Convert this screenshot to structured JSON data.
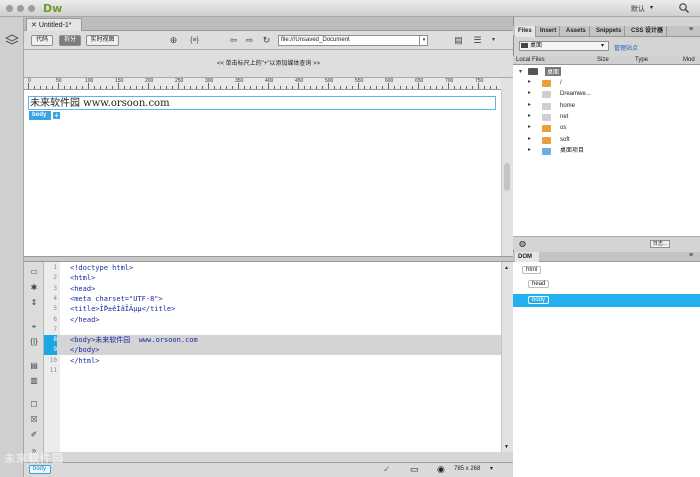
{
  "app": {
    "logo": "Dw",
    "workspace": "默认"
  },
  "document": {
    "tab_title": "Untitled-1*"
  },
  "toolbar": {
    "views": [
      "代码",
      "拆分",
      "实时视图"
    ],
    "active_view": "拆分",
    "address": "file:///Unsaved_Document"
  },
  "media_hint": "<< 单击标尺上的\"+\"以添加媒体查询 >>",
  "ruler": {
    "labels": [
      "0",
      "50",
      "100",
      "150",
      "200",
      "250",
      "300",
      "350",
      "400",
      "450",
      "500",
      "550",
      "600",
      "650",
      "700",
      "750"
    ]
  },
  "design": {
    "body_text": "未来软件园 www.orsoon.com",
    "body_tag": "body",
    "plus": "+"
  },
  "code": {
    "lines": [
      {
        "n": "1",
        "t": "<!doctype html>"
      },
      {
        "n": "2",
        "t": "<html>"
      },
      {
        "n": "3",
        "t": "<head>"
      },
      {
        "n": "4",
        "t": "<meta charset=\"UTF-8\">"
      },
      {
        "n": "5",
        "t": "<title>Î̃Þ±êÌâÎÄµµ</title>"
      },
      {
        "n": "6",
        "t": "</head>"
      },
      {
        "n": "7",
        "t": ""
      },
      {
        "n": "8",
        "t": "<body>未来软件园  www.orsoon.com"
      },
      {
        "n": "9",
        "t": "</body>"
      },
      {
        "n": "10",
        "t": "</html>"
      },
      {
        "n": "11",
        "t": ""
      }
    ],
    "highlighted": [
      "8",
      "9"
    ]
  },
  "status": {
    "tag": "body",
    "size": "785 x 268"
  },
  "panel": {
    "tabs": [
      "Files",
      "Insert",
      "Assets",
      "Snippets",
      "CSS 设计器"
    ],
    "site": "桌面",
    "manage_sites": "管理站点",
    "columns": [
      "Local Files",
      "Size",
      "Type",
      "Mod"
    ],
    "root": "桌面",
    "files": [
      {
        "name": "/",
        "color": "#e8a13a"
      },
      {
        "name": "Dreamwe...",
        "color": "#cfcfcf"
      },
      {
        "name": "home",
        "color": "#cfcfcf"
      },
      {
        "name": "net",
        "color": "#cfcfcf"
      },
      {
        "name": "os",
        "color": "#e8a13a"
      },
      {
        "name": "soft",
        "color": "#e8a13a"
      },
      {
        "name": "桌面项目",
        "color": "#6ab0e8"
      }
    ],
    "log": "日志..."
  },
  "dom": {
    "tab": "DOM",
    "nodes": [
      "html",
      "head",
      "body"
    ]
  },
  "watermark": "未来软件园"
}
